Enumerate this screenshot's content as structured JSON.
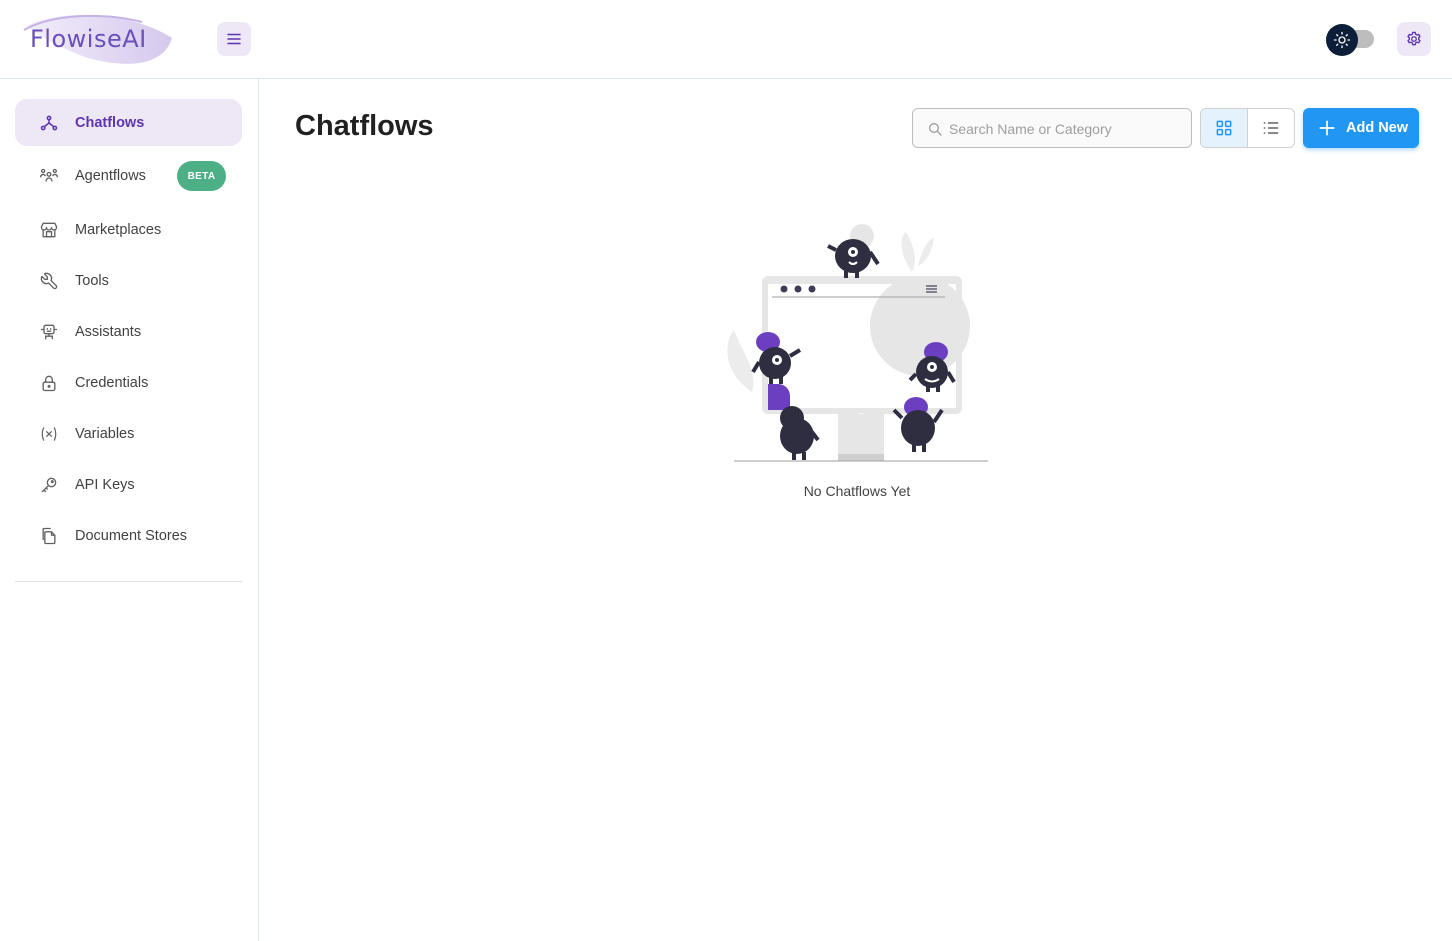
{
  "header": {
    "logo_text": "FlowiseAI",
    "menu_icon": "hamburger-icon",
    "theme_icon": "sun-icon",
    "settings_icon": "gear-icon"
  },
  "sidebar": {
    "items": [
      {
        "label": "Chatflows",
        "icon": "chatflows-icon",
        "active": true
      },
      {
        "label": "Agentflows",
        "icon": "agents-icon",
        "badge": "BETA"
      },
      {
        "label": "Marketplaces",
        "icon": "store-icon"
      },
      {
        "label": "Tools",
        "icon": "tool-icon"
      },
      {
        "label": "Assistants",
        "icon": "robot-icon"
      },
      {
        "label": "Credentials",
        "icon": "lock-icon"
      },
      {
        "label": "Variables",
        "icon": "variable-icon"
      },
      {
        "label": "API Keys",
        "icon": "key-icon"
      },
      {
        "label": "Document Stores",
        "icon": "files-icon"
      }
    ]
  },
  "main": {
    "title": "Chatflows",
    "search": {
      "placeholder": "Search Name or Category",
      "value": ""
    },
    "view": {
      "options": [
        "card",
        "list"
      ],
      "selected": "card"
    },
    "add_button_label": "Add New",
    "empty_text": "No Chatflows Yet"
  },
  "colors": {
    "accent_purple": "#5e35b1",
    "active_bg": "#ede7f6",
    "primary_blue": "#2196f3",
    "beta_green": "#4caf85"
  }
}
